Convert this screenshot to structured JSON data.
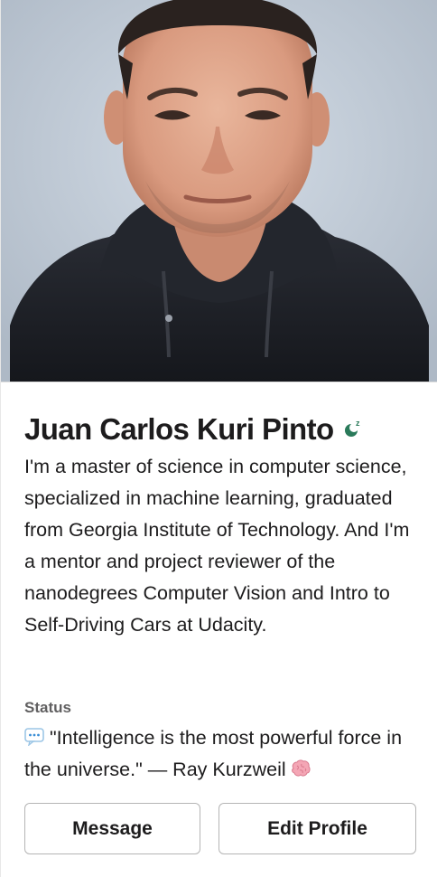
{
  "profile": {
    "name": "Juan Carlos Kuri Pinto",
    "presence_icon": "away-snooze-icon",
    "bio": "I'm a master of science in computer science, specialized in machine learning, graduated from Georgia Institute of Technology. And I'm a mentor and project reviewer of the nanodegrees Computer Vision and Intro to Self-Driving Cars at Udacity.",
    "photo_icon": "profile-photo"
  },
  "status": {
    "label": "Status",
    "emoji": "speech-balloon-icon",
    "text": "\"Intelligence is the most powerful force in the universe.\" — Ray Kurzweil",
    "trailing_emoji": "brain-icon"
  },
  "actions": {
    "message_label": "Message",
    "edit_profile_label": "Edit Profile"
  },
  "colors": {
    "presence": "#2a7a5a",
    "text_primary": "#1d1c1d",
    "text_secondary": "#616061",
    "button_border": "#b5b5b5"
  }
}
